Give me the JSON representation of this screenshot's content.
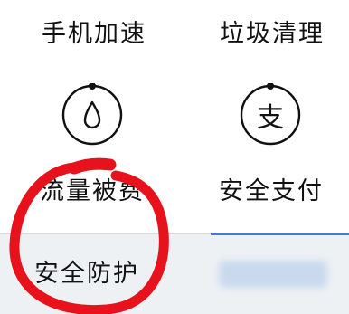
{
  "grid": {
    "top_left_label": "手机加速",
    "top_right_label": "垃圾清理",
    "mid_left_label": "流量被费",
    "mid_right_label": "安全支付",
    "pay_icon_glyph": "支"
  },
  "tab_bar": {
    "left_tab_label": "安全防护",
    "right_tab_label": ""
  },
  "colors": {
    "annotation_red": "#e8121c",
    "active_indicator": "#3f7fd0",
    "bar_background": "#eef1f4"
  },
  "icons": {
    "data_icon": "water-drop-icon",
    "pay_icon": "payment-icon"
  }
}
